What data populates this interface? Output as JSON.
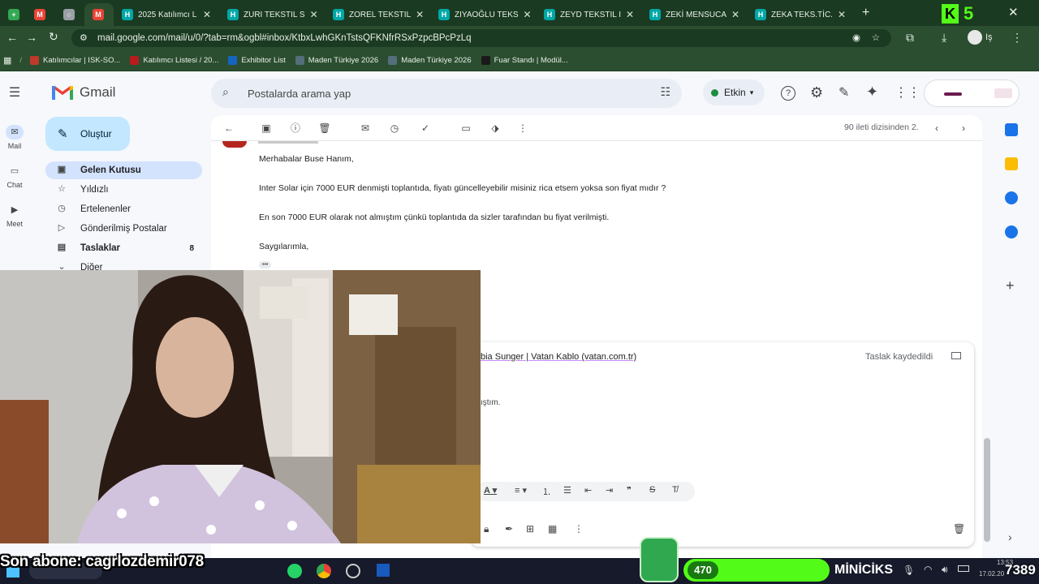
{
  "browser": {
    "tabs": [
      {
        "label": "",
        "icon": "plus-square-icon",
        "color": "#34a853"
      },
      {
        "label": "",
        "icon": "gmail-icon",
        "color": "#ea4335"
      },
      {
        "label": "",
        "icon": "globe-icon",
        "color": "#9aa0a6"
      },
      {
        "label": "",
        "icon": "gmail-icon",
        "color": "#ea4335",
        "active": true
      },
      {
        "label": "2025 Katılımcı L",
        "icon": "h-icon",
        "color": "#00a7a7"
      },
      {
        "label": "ZURI TEKSTIL S",
        "icon": "h-icon",
        "color": "#00a7a7"
      },
      {
        "label": "ZOREL TEKSTIL",
        "icon": "h-icon",
        "color": "#00a7a7"
      },
      {
        "label": "ZIYAOĞLU TEKS",
        "icon": "h-icon",
        "color": "#00a7a7"
      },
      {
        "label": "ZEYD TEKSTIL I",
        "icon": "h-icon",
        "color": "#00a7a7"
      },
      {
        "label": "ZEKİ MENSUCA",
        "icon": "h-icon",
        "color": "#00a7a7"
      },
      {
        "label": "ZEKA TEKS.TİC.",
        "icon": "h-icon",
        "color": "#00a7a7"
      }
    ],
    "new_tab": "+",
    "url": "mail.google.com/mail/u/0/?tab=rm&ogbl#inbox/KtbxLwhGKnTstsQFKNfrRSxPzpcBPcPzLq",
    "profile_short": "Iş",
    "bookmarks": [
      {
        "label": "Katılımcılar | ISK-SO...",
        "color": "#c0392b"
      },
      {
        "label": "Katılımcı Listesi / 20...",
        "color": "#b71c1c"
      },
      {
        "label": "Exhibitor List",
        "color": "#1565c0"
      },
      {
        "label": "Maden Türkiye 2026",
        "color": "#546e7a"
      },
      {
        "label": "Maden Türkiye 2026",
        "color": "#546e7a"
      },
      {
        "label": "Fuar Standı | Modül...",
        "color": "#1a1a1a"
      }
    ],
    "kick_logo_text": "K",
    "kick_number": "5"
  },
  "gmail": {
    "app_name": "Gmail",
    "search_placeholder": "Postalarda arama yap",
    "status": "Etkin",
    "compose_label": "Oluştur",
    "rail": [
      {
        "label": "Mail",
        "icon": "mail-icon"
      },
      {
        "label": "Chat",
        "icon": "chat-icon"
      },
      {
        "label": "Meet",
        "icon": "meet-icon"
      }
    ],
    "nav": [
      {
        "label": "Gelen Kutusu",
        "icon": "inbox-icon",
        "selected": true,
        "count": ""
      },
      {
        "label": "Yıldızlı",
        "icon": "star-icon",
        "count": ""
      },
      {
        "label": "Ertelenenler",
        "icon": "clock-icon",
        "count": ""
      },
      {
        "label": "Gönderilmiş Postalar",
        "icon": "send-icon",
        "count": ""
      },
      {
        "label": "Taslaklar",
        "icon": "draft-icon",
        "count": "8",
        "bold": true
      },
      {
        "label": "Diğer",
        "icon": "chevron-down-icon",
        "count": ""
      }
    ],
    "pager_text": "90 ileti dizisinden 2.",
    "email_body": [
      "Merhabalar Buse Hanım,",
      "Inter Solar için 7000 EUR denmişti toplantıda, fiyatı güncelleyebilir misiniz rica etsem yoksa son fiyat mıdır ?",
      "En son 7000 EUR olarak not almıştım çünkü toplantıda da sizler tarafından bu fiyat verilmişti.",
      "Saygılarımla,"
    ],
    "ellipsis": "•••",
    "reply_subject_fragment": "bia Sunger | Vatan Kablo (vatan.com.tr)",
    "reply_status": "Taslak kaydedildi",
    "reply_fragment": "ıştım."
  },
  "overlay": {
    "subscriber_text": "Son abone: cagrlozdemir078",
    "viewer_count": "470",
    "streamer": "MİNİCİKS",
    "clock": "13:53",
    "date": "17.02.20",
    "right_number": "7389"
  }
}
